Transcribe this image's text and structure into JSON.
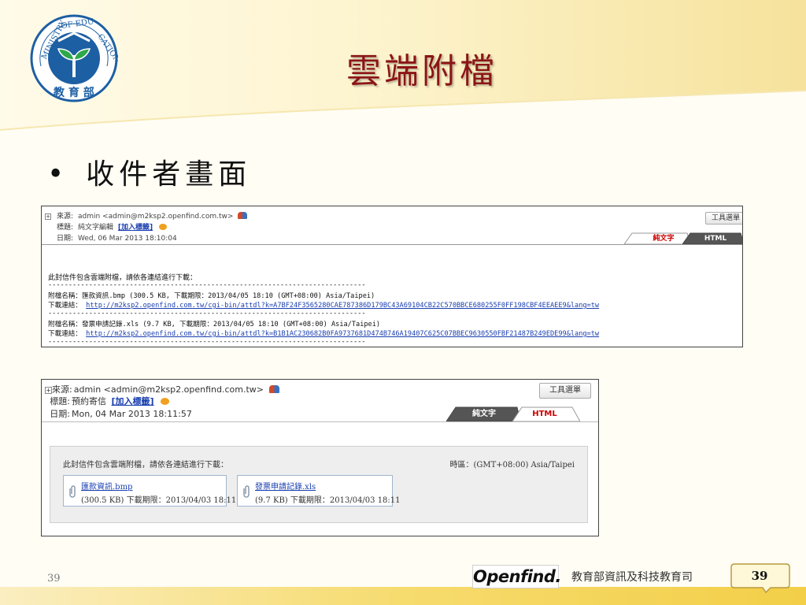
{
  "slide": {
    "title": "雲端附檔",
    "bullet": "收件者畫面",
    "page_number": "39",
    "department": "教育部資訊及科技教育司",
    "logo_text": "Openfind.",
    "ministry_seal_text": "MINISTRY OF EDUCATION 教育部"
  },
  "shot1": {
    "from_label": "來源:",
    "from_value": "admin <admin@m2ksp2.openfind.com.tw>",
    "subject_label": "標題:",
    "subject_value": "純文字編輯",
    "add_tag": "[加入標籤]",
    "date_label": "日期:",
    "date_value": "Wed, 06 Mar 2013 18:10:04",
    "tools_button": "工具選單",
    "tab_plain": "純文字",
    "tab_html": "HTML",
    "notice": "此封信件包含雲端附檔，請依各連結進行下載：",
    "dashes": "------------------------------------------------------------------------------",
    "att1_line": "附檔名稱：匯款資訊.bmp (300.5 KB, 下載期限：2013/04/05 18:10 (GMT+08:00) Asia/Taipei)",
    "link_label": "下載連結：",
    "att1_url": "http://m2ksp2.openfind.com.tw/cgi-bin/attdl?k=A7BF24F3565280CAE787386D179BC43A69104CB22C570BBCE680255F0FF198CBF4EEAEE9&lang=tw",
    "att2_line": "附檔名稱：發票申請記錄.xls (9.7 KB, 下載期限：2013/04/05 18:10 (GMT+08:00) Asia/Taipei)",
    "att2_url": "http://m2ksp2.openfind.com.tw/cgi-bin/attdl?k=B1B1AC230682B0FA9737681D474B746A19407C625C07BBEC9630550FBF21487B249EDE99&lang=tw"
  },
  "shot2": {
    "from_label": "來源:",
    "from_value": "admin <admin@m2ksp2.openfind.com.tw>",
    "subject_label": "標題:",
    "subject_value": "預約寄信",
    "add_tag": "[加入標籤]",
    "date_label": "日期:",
    "date_value": "Mon, 04 Mar 2013 18:11:57",
    "tools_button": "工具選單",
    "tab_plain": "純文字",
    "tab_html": "HTML",
    "notice": "此封信件包含雲端附檔，請依各連結進行下載：",
    "timezone": "時區：(GMT+08:00) Asia/Taipei",
    "attachments": [
      {
        "name": "匯款資訊.bmp",
        "meta": "(300.5 KB) 下載期限：2013/04/03 18:11"
      },
      {
        "name": "發票申請記錄.xls",
        "meta": "(9.7 KB) 下載期限：2013/04/03 18:11"
      }
    ]
  },
  "colors": {
    "title_red": "#8b1516",
    "link_blue": "#1a3fb0",
    "footer_gold": "#f3cf48"
  }
}
